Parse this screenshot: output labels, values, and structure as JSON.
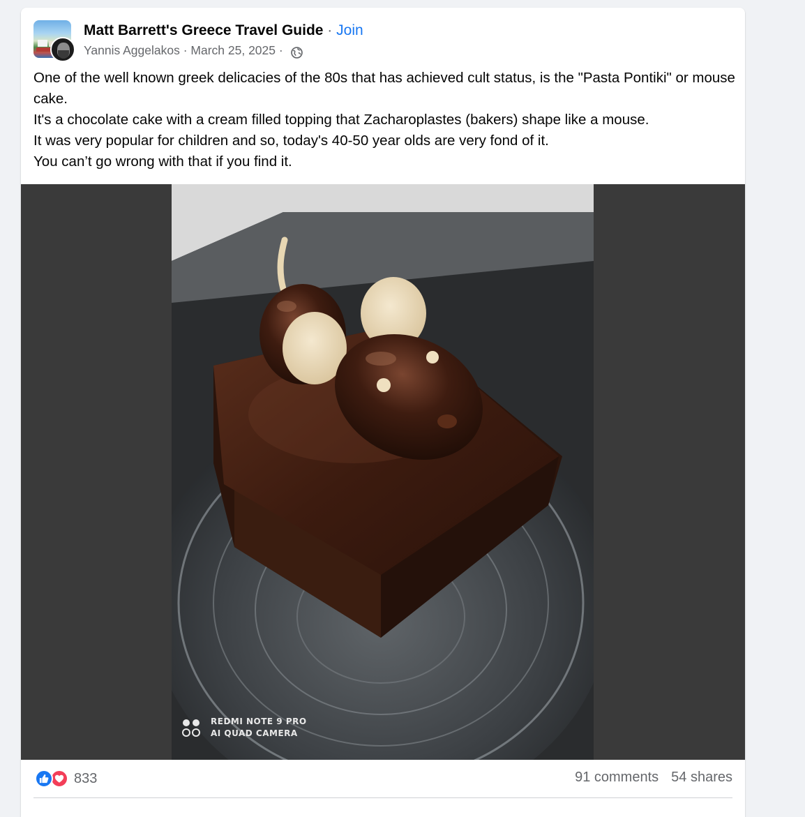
{
  "post": {
    "group_name": "Matt Barrett's Greece Travel Guide",
    "separator": " · ",
    "join_label": "Join",
    "author": "Yannis Aggelakos",
    "date": "March 25, 2025",
    "meta_separator": " · ",
    "privacy_icon": "globe-icon",
    "text_lines": [
      "One of the well known greek delicacies of the 80s that has achieved cult status, is the \"Pasta Pontiki\" or mouse cake.",
      "It's a chocolate cake with a cream filled topping that Zacharoplastes (bakers) shape like a mouse.",
      "It was very popular for children and so, today's 40-50 year olds are very fond of it.",
      "You can’t go wrong with that if you find it."
    ],
    "photo_watermark": {
      "line1": "REDMI NOTE 9 PRO",
      "line2": "AI QUAD CAMERA"
    }
  },
  "footer": {
    "reaction_icons": [
      "like-icon",
      "love-icon"
    ],
    "reaction_count": "833",
    "comments": "91 comments",
    "shares": "54 shares"
  },
  "colors": {
    "accent": "#1877f2",
    "love": "#f33e58",
    "secondary_text": "#65676b",
    "page_bg": "#f0f2f5"
  }
}
